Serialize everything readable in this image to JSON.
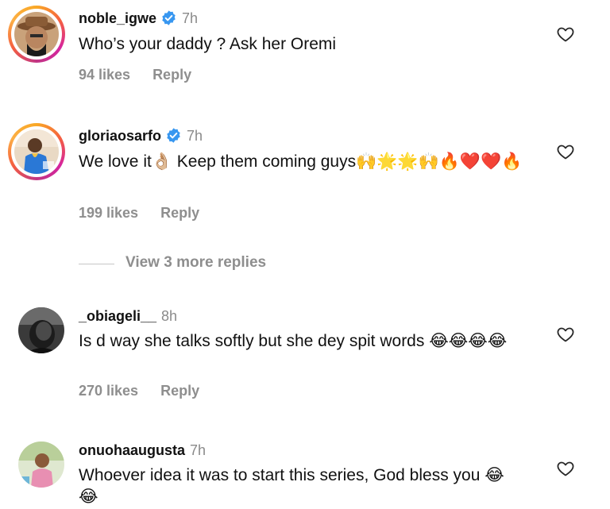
{
  "comments": [
    {
      "username": "noble_igwe",
      "verified": true,
      "time": "7h",
      "text": "Who’s your daddy ? Ask her Oremi",
      "likes": "94 likes",
      "reply": "Reply"
    },
    {
      "username": "gloriaosarfo",
      "verified": true,
      "time": "7h",
      "text": "We love it👌🏼 Keep them coming guys🙌🌟🌟🙌🔥❤️❤️🔥",
      "likes": "199 likes",
      "reply": "Reply"
    },
    {
      "username": "_obiageli__",
      "verified": false,
      "time": "8h",
      "text": "Is d way she talks softly but she dey spit words 😂😂😂😂",
      "likes": "270 likes",
      "reply": "Reply"
    },
    {
      "username": "onuohaaugusta",
      "verified": false,
      "time": "7h",
      "text": "Whoever idea it was to start this series, God bless you 😂😂"
    }
  ],
  "view_replies": "View 3 more replies",
  "colors": {
    "verified_blue": "#3897f0",
    "muted_text": "#8e8e8e",
    "story_ring": [
      "#fcaf45",
      "#f56040",
      "#c13584"
    ]
  },
  "icons": [
    "verified-badge-icon",
    "heart-outline-icon"
  ]
}
